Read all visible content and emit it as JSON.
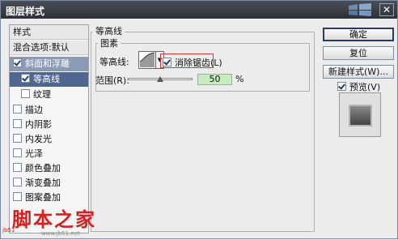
{
  "window": {
    "title": "图层样式",
    "close_glyph": "✕"
  },
  "sidebar": {
    "header": "样式",
    "blend": "混合选项:默认",
    "items": [
      {
        "label": "斜面和浮雕",
        "checked": true
      },
      {
        "label": "等高线",
        "checked": true
      },
      {
        "label": "纹理",
        "checked": false
      },
      {
        "label": "描边",
        "checked": false
      },
      {
        "label": "内阴影",
        "checked": false
      },
      {
        "label": "内发光",
        "checked": false
      },
      {
        "label": "光泽",
        "checked": false
      },
      {
        "label": "颜色叠加",
        "checked": false
      },
      {
        "label": "渐变叠加",
        "checked": false
      },
      {
        "label": "图案叠加",
        "checked": false
      }
    ]
  },
  "main": {
    "group_title": "等高线",
    "sub_group_title": "图素",
    "contour_label": "等高线:",
    "antialias_label": "消除锯齿(L)",
    "antialias_checked": true,
    "range_label": "范围(R):",
    "range_value": "50",
    "range_unit": "%"
  },
  "buttons": {
    "ok": "确定",
    "reset": "复位",
    "new_style": "新建样式(W)...",
    "preview_label": "预览(V)",
    "preview_checked": true
  },
  "watermark": {
    "main": "脚本之家",
    "small": "jb51",
    "url": "www.jb51.net"
  }
}
